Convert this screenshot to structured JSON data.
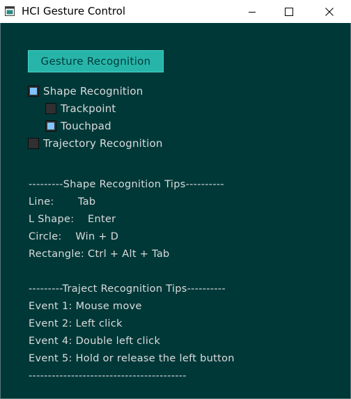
{
  "window": {
    "title": "HCI Gesture Control"
  },
  "gesture_button": {
    "label": "Gesture Recognition"
  },
  "options": {
    "shape": {
      "label": "Shape Recognition",
      "checked": true
    },
    "trackpoint": {
      "label": "Trackpoint",
      "checked": false
    },
    "touchpad": {
      "label": "Touchpad",
      "checked": true
    },
    "trajectory": {
      "label": "Trajectory Recognition",
      "checked": false
    }
  },
  "shape_tips": {
    "header": "---------Shape Recognition Tips----------",
    "lines": [
      "Line:       Tab",
      "L Shape:    Enter",
      "Circle:    Win + D",
      "Rectangle: Ctrl + Alt + Tab"
    ]
  },
  "trajectory_tips": {
    "header": "---------Traject Recognition Tips----------",
    "lines": [
      "Event 1: Mouse move",
      "Event 2: Left click",
      "Event 4: Double left click",
      "Event 5: Hold or release the left button"
    ],
    "footer": "-----------------------------------------"
  },
  "colors": {
    "background": "#003838",
    "button": "#27b5aa",
    "check_mark": "#80c4ff",
    "text": "#dcdcdc"
  }
}
